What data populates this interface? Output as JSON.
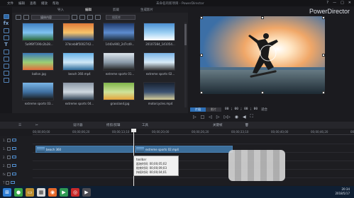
{
  "window": {
    "menu": [
      "文件",
      "编辑",
      "查看",
      "播放",
      "帮助"
    ],
    "title": "未命名的新项目 - PowerDirector",
    "app_name": "PowerDirector",
    "controls": [
      "?",
      "—",
      "□",
      "✕"
    ]
  },
  "library": {
    "tabs": [
      "导入",
      "编辑",
      "剪裁",
      "生成影片"
    ],
    "filter_select": "媒体内容",
    "search_placeholder": "搜索库",
    "items": [
      {
        "caption": "5a9f8f7390c2b28...",
        "colors": [
          "#3f7fc1",
          "#7fc2f0",
          "#2d6a3a"
        ]
      },
      {
        "caption": "37dceb8f5002742...",
        "colors": [
          "#e07a38",
          "#f7c46b",
          "#2a4f86"
        ]
      },
      {
        "caption": "1440x900_2d7cd9...",
        "colors": [
          "#1e3a6d",
          "#5d8ccf",
          "#203040"
        ]
      },
      {
        "caption": "20107284_141054...",
        "colors": [
          "#4b8fd2",
          "#9cd0f3",
          "#ffffff"
        ]
      },
      {
        "caption": "ballon.jpg",
        "colors": [
          "#3a79b9",
          "#9ccf74",
          "#e46c3a"
        ]
      },
      {
        "caption": "beach 360.mp4",
        "colors": [
          "#67b2e8",
          "#cfe8f7",
          "#2b6a9a"
        ]
      },
      {
        "caption": "extreme sports 01...",
        "colors": [
          "#dde6ee",
          "#8a9aa8",
          "#222"
        ]
      },
      {
        "caption": "extreme sports 02...",
        "colors": [
          "#7ab3e6",
          "#d9ecf8",
          "#3a3a3a"
        ]
      },
      {
        "caption": "extreme sports 03...",
        "colors": [
          "#7bb7e8",
          "#3f6f9f",
          "#1a1a1a"
        ]
      },
      {
        "caption": "extreme sports 04...",
        "colors": [
          "#8a96a5",
          "#cfd8e0",
          "#324455"
        ]
      },
      {
        "caption": "grassland.jpg",
        "colors": [
          "#7fb54a",
          "#cfe39a",
          "#e6a33a"
        ]
      },
      {
        "caption": "motorcycles.mp4",
        "colors": [
          "#1a2330",
          "#3b5272",
          "#d9cf99"
        ]
      }
    ]
  },
  "preview": {
    "modes": [
      "片段",
      "影片"
    ],
    "timecode": "00 ; 00 ; 00 ; 00",
    "fit": "适合"
  },
  "timeline": {
    "toolbar": [
      "设计器",
      "修剪/剪辑",
      "工具",
      "关键帧"
    ],
    "ruler": [
      "00;00;00;00",
      "00;00;06;20",
      "00;00;13;10",
      "00;00;20;00",
      "00;00;26;20",
      "00;00;33;10",
      "00;00;40;00",
      "00;00;46;20",
      "00;00;53;10"
    ],
    "tracks": [
      "1.",
      "1.",
      "2.",
      "2.",
      "fx",
      "T"
    ],
    "clips": [
      {
        "label": "beach 360",
        "track": 0
      },
      {
        "label": "extreme sports 02.mp4",
        "track": 0
      }
    ],
    "tooltip": {
      "title": "toolbar",
      "lines": [
        "起始时间: 00;00;05;02",
        "结束时间: 00;00;09;03",
        "持续时间: 00;00;04;01"
      ]
    }
  },
  "taskbar": {
    "time": "20:34",
    "date": "2018/5/17"
  }
}
